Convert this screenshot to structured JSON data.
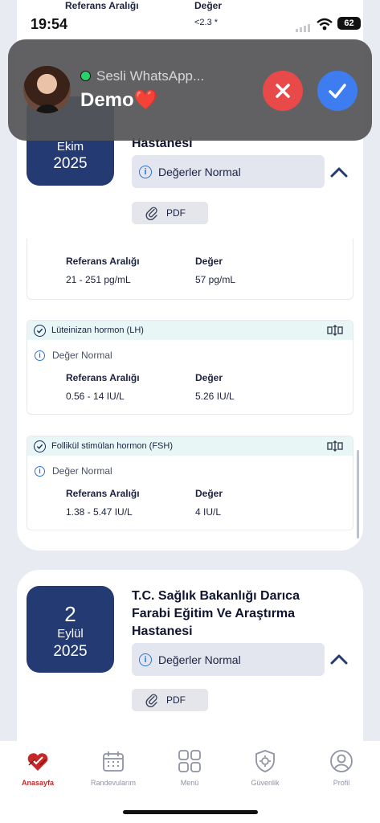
{
  "status_bar": {
    "time": "19:54",
    "battery": "62"
  },
  "top_partial": {
    "ref_label": "Referans Aralığı",
    "value_label": "Değer",
    "value": "<2.3 *"
  },
  "notification": {
    "app_title": "Sesli WhatsApp...",
    "caller_name": "Demo",
    "heart": "❤️",
    "colors": {
      "decline": "#e84a4a",
      "accept": "#3d7df0",
      "whatsapp": "#25d366"
    }
  },
  "card1": {
    "month": "Ekim",
    "year": "2025",
    "hospital_fragment": "Hastanesi",
    "status": "Değerler Normal",
    "pdf_label": "PDF",
    "partial_test": {
      "ref_label": "Referans Aralığı",
      "value_label": "Değer",
      "ref_range": "21 - 251 pg/mL",
      "value": "57 pg/mL"
    },
    "tests": [
      {
        "name": "Lüteinizan hormon (LH)",
        "note": "Değer Normal",
        "ref_label": "Referans Aralığı",
        "value_label": "Değer",
        "ref_range": "0.56 - 14 IU/L",
        "value": "5.26 IU/L"
      },
      {
        "name": "Follikül stimülan hormon (FSH)",
        "note": "Değer Normal",
        "ref_label": "Referans Aralığı",
        "value_label": "Değer",
        "ref_range": "1.38 - 5.47 IU/L",
        "value": "4 IU/L"
      }
    ]
  },
  "card2": {
    "day": "2",
    "month": "Eylül",
    "year": "2025",
    "hospital_lines": [
      "T.C. Sağlık Bakanlığı Darıca",
      "Farabi Eğitim Ve Araştırma",
      "Hastanesi"
    ],
    "status": "Değerler Normal",
    "pdf_label": "PDF"
  },
  "tabbar": {
    "active_color": "#c62828",
    "items": [
      {
        "label": "Anasayfa",
        "icon": "heart-icon",
        "active": true
      },
      {
        "label": "Randevularım",
        "icon": "calendar-icon",
        "active": false
      },
      {
        "label": "Menü",
        "icon": "grid-icon",
        "active": false
      },
      {
        "label": "Güvenlik",
        "icon": "shield-gear-icon",
        "active": false
      },
      {
        "label": "Profil",
        "icon": "user-icon",
        "active": false
      }
    ]
  }
}
